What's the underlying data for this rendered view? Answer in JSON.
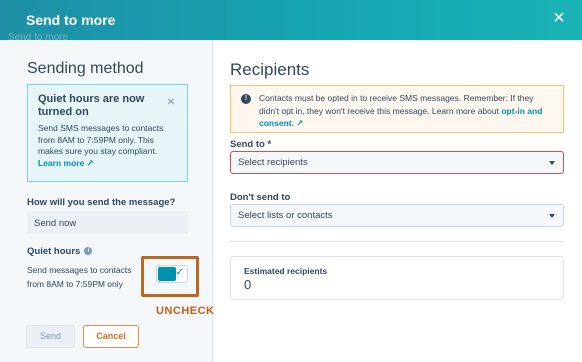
{
  "header": {
    "title": "Send to more",
    "close_glyph": "✕"
  },
  "ghost_text": "Send to more",
  "left": {
    "title": "Sending method",
    "quiet_hours_alert": {
      "title": "Quiet hours are now turned on",
      "body": "Send SMS messages to contacts from 8AM to 7:59PM only. This makes sure you stay compliant.",
      "link": "Learn more ↗"
    },
    "how_label": "How will you send the message?",
    "send_mode": "Send now",
    "quiet_label": "Quiet hours",
    "quiet_desc": "Send messages to contacts from 8AM to 7:59PM only",
    "toggle_state": "on",
    "annotation": "UNCHECK"
  },
  "footer": {
    "send_label": "Send",
    "cancel_label": "Cancel"
  },
  "right": {
    "title": "Recipients",
    "alert": {
      "text": "Contacts must be opted in to receive SMS messages. Remember: If they didn't opt in, they won't receive this message. Learn more about ",
      "link": "opt-in and consent. ↗"
    },
    "send_to_label": "Send to *",
    "send_to_placeholder": "Select recipients",
    "dont_send_label": "Don't send to",
    "dont_send_placeholder": "Select lists or contacts",
    "estimated_label": "Estimated recipients",
    "estimated_value": "0"
  },
  "colors": {
    "accent": "#0091ae",
    "header": "#16a7b3",
    "annotation": "#c45f1a",
    "error": "#d94c53"
  }
}
